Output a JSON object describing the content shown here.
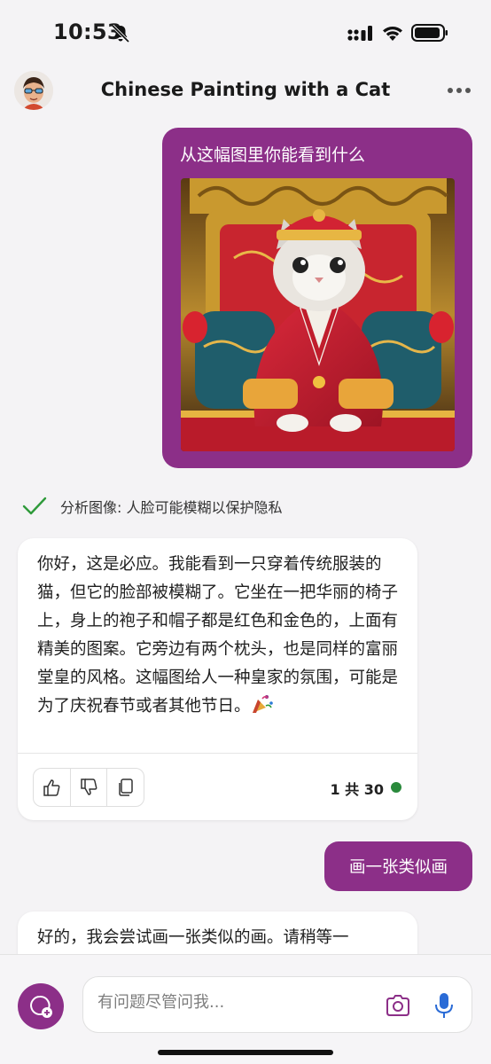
{
  "status_bar": {
    "time": "10:53"
  },
  "header": {
    "title": "Chinese Painting with a Cat"
  },
  "messages": {
    "user_image_prompt": "从这幅图里你能看到什么",
    "analysis_note": "分析图像: 人脸可能模糊以保护隐私",
    "bot_reply_1": "你好，这是必应。我能看到一只穿着传统服装的猫，但它的脸部被模糊了。它坐在一把华丽的椅子上，身上的袍子和帽子都是红色和金色的，上面有精美的图案。它旁边有两个枕头，也是同样的富丽堂皇的风格。这幅图给人一种皇家的氛围，可能是为了庆祝春节或者其他节日。",
    "turn_counter": "1 共 30",
    "user_text": "画一张类似画",
    "bot_reply_2": "好的，我会尝试画一张类似的画。请稍等一"
  },
  "composer": {
    "placeholder": "有问题尽管问我..."
  },
  "colors": {
    "accent": "#8c2f88",
    "status_ok": "#2a8a3c",
    "check": "#2e9a3a"
  },
  "icons": [
    "bell-slash-icon",
    "signal-icon",
    "wifi-icon",
    "battery-icon",
    "more-icon",
    "check-icon",
    "party-popper-icon",
    "thumbs-up-icon",
    "thumbs-down-icon",
    "copy-icon",
    "new-topic-icon",
    "camera-icon",
    "microphone-icon"
  ]
}
